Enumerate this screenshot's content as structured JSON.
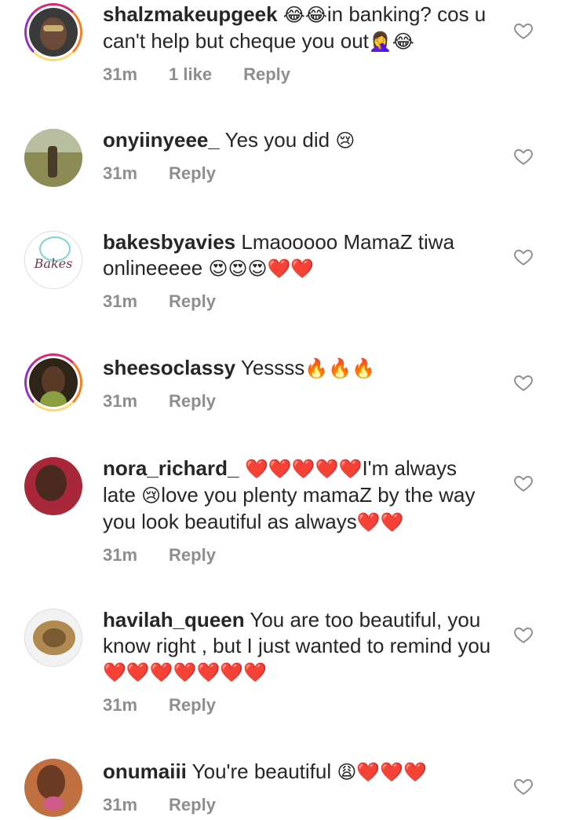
{
  "comments": [
    {
      "username": "shalzmakeupgeek",
      "text_before": " ",
      "emoji1": "😂😂",
      "text_after": "in banking? cos u can't help but cheque you out",
      "emoji2": "🤦‍♀️😂",
      "time": "31m",
      "likes": "1 like",
      "reply": "Reply"
    },
    {
      "username": "onyiinyeee_",
      "text": " Yes you did ",
      "emoji": "😢",
      "time": "31m",
      "reply": "Reply"
    },
    {
      "username": "bakesbyavies",
      "text": " Lmaooooo MamaZ tiwa onlineeeee ",
      "emoji": "😍😍😍❤️❤️",
      "avatar_text": "Bakes",
      "time": "31m",
      "reply": "Reply"
    },
    {
      "username": "sheesoclassy",
      "text": " Yessss",
      "emoji": "🔥🔥🔥",
      "time": "31m",
      "reply": "Reply"
    },
    {
      "username": "nora_richard_",
      "emoji1": " ❤️❤️❤️❤️❤️",
      "text1": "I'm always late ",
      "emoji2": "😢",
      "text2": "love you plenty mamaZ by the way you look beautiful as always",
      "emoji3": "❤️❤️",
      "time": "31m",
      "reply": "Reply"
    },
    {
      "username": "havilah_queen",
      "text": " You are too beautiful, you know right , but I just wanted to remind you",
      "emoji": "❤️❤️❤️❤️❤️❤️❤️",
      "time": "31m",
      "reply": "Reply"
    },
    {
      "username": "onumaiii",
      "text": " You're beautiful ",
      "emoji": "😩❤️❤️❤️",
      "time": "31m",
      "reply": "Reply"
    }
  ],
  "colors": {
    "text": "#262626",
    "meta": "#8e8e8e",
    "story_ring": "#d62976"
  }
}
